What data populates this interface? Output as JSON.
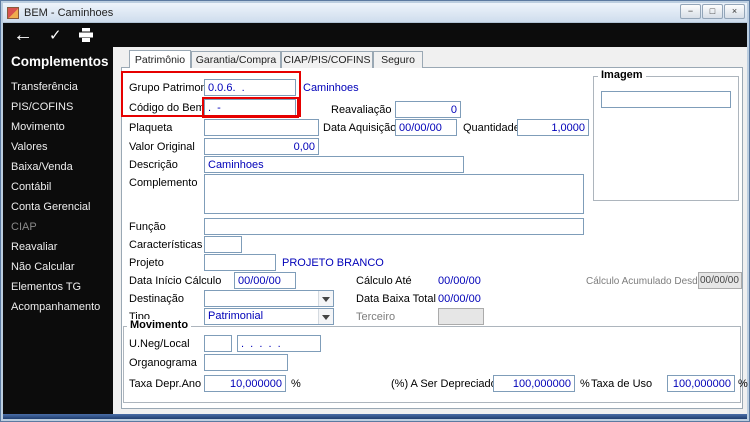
{
  "window": {
    "title": "BEM - Caminhoes",
    "controls": {
      "minimize": "−",
      "maximize": "□",
      "close": "×"
    }
  },
  "toolbar": {
    "back_glyph": "←",
    "confirm_glyph": "✓"
  },
  "sidebar": {
    "header": "Complementos",
    "items": [
      "Transferência",
      "PIS/COFINS",
      "Movimento",
      "Valores",
      "Baixa/Venda",
      "Contábil",
      "Conta Gerencial",
      "CIAP",
      "Reavaliar",
      "Não Calcular",
      "Elementos TG",
      "Acompanhamento"
    ]
  },
  "tabs": [
    "Patrimônio",
    "Garantia/Compra",
    "CIAP/PIS/COFINS",
    "Seguro"
  ],
  "form": {
    "groups": {
      "movimento": "Movimento",
      "imagem": "Imagem"
    },
    "grupo_patrimonial": {
      "label": "Grupo Patrimonial",
      "value": "0.0.6.  .",
      "name": "Caminhoes"
    },
    "codigo_bem": {
      "label": "Código do Bem",
      "value": ".  -"
    },
    "reavaliacao": {
      "label": "Reavaliação",
      "value": "0"
    },
    "plaqueta": {
      "label": "Plaqueta",
      "value": ""
    },
    "data_aquisicao": {
      "label": "Data Aquisição",
      "value": "00/00/00"
    },
    "quantidade": {
      "label": "Quantidade",
      "value": "1,0000"
    },
    "valor_original": {
      "label": "Valor Original",
      "value": "0,00"
    },
    "descricao": {
      "label": "Descrição",
      "value": "Caminhoes"
    },
    "complemento": {
      "label": "Complemento",
      "value": ""
    },
    "funcao": {
      "label": "Função",
      "value": ""
    },
    "caracteristicas": {
      "label": "Características",
      "value": ""
    },
    "projeto": {
      "label": "Projeto",
      "value": "",
      "name": "PROJETO BRANCO"
    },
    "data_inicio_calculo": {
      "label": "Data Início Cálculo",
      "value": "00/00/00"
    },
    "calculo_ate": {
      "label": "Cálculo Até",
      "value": "00/00/00"
    },
    "calculo_acumulado_desde": {
      "label": "Cálculo Acumulado Desde",
      "value": "00/00/00"
    },
    "destinacao": {
      "label": "Destinação",
      "value": ""
    },
    "data_baixa_total": {
      "label": "Data Baixa Total",
      "value": "00/00/00"
    },
    "tipo": {
      "label": "Tipo",
      "value": "Patrimonial"
    },
    "terceiro": {
      "label": "Terceiro",
      "value": ""
    },
    "uneg_local": {
      "label": "U.Neg/Local",
      "value1": "",
      "value2": ".  .  .  .  ."
    },
    "organograma": {
      "label": "Organograma",
      "value": ""
    },
    "taxa_depr_ano": {
      "label": "Taxa Depr.Ano",
      "value": "10,000000",
      "suffix": "%"
    },
    "a_ser_depreciado": {
      "label": "(%) A Ser Depreciado",
      "value": "100,000000",
      "suffix": "%"
    },
    "taxa_uso": {
      "label": "Taxa de Uso",
      "value": "100,000000",
      "suffix": "%"
    }
  }
}
